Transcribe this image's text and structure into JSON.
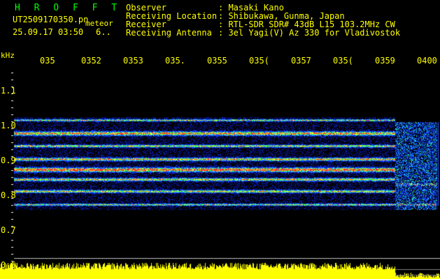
{
  "header": {
    "app_title": "H R O F F T",
    "file_name": "UT2509170350.pn",
    "file_suffix": "meteor",
    "date_time": "25.09.17 03:50",
    "field_extra": "6..",
    "labels": [
      "Observer",
      "Receiving Location",
      "Receiver",
      "Receiving Antenna"
    ],
    "values": [
      ": Masaki Kano",
      ": Shibukawa, Gunma, Japan",
      ": RTL-SDR SDR# 43dB L15 103.2MHz CW",
      ": 3el Yagi(V) Az 330 for Vladivostok"
    ]
  },
  "axis": {
    "unit": "kHz",
    "freq_ticks": [
      "1.1",
      "1.0",
      "0.9",
      "0.8",
      "0.7",
      "0.6"
    ],
    "time_ticks": [
      "035",
      "0352",
      "0353",
      "035.",
      "0355",
      "035(",
      "0357",
      "035(",
      "0359",
      "0400"
    ]
  },
  "colors": {
    "text_green": "#00ff00",
    "text_yellow": "#ffff00",
    "background": "#000000",
    "signal_red": "#ff2020",
    "signal_yellow": "#ffff30",
    "noise_blue": "#1030ff"
  }
}
